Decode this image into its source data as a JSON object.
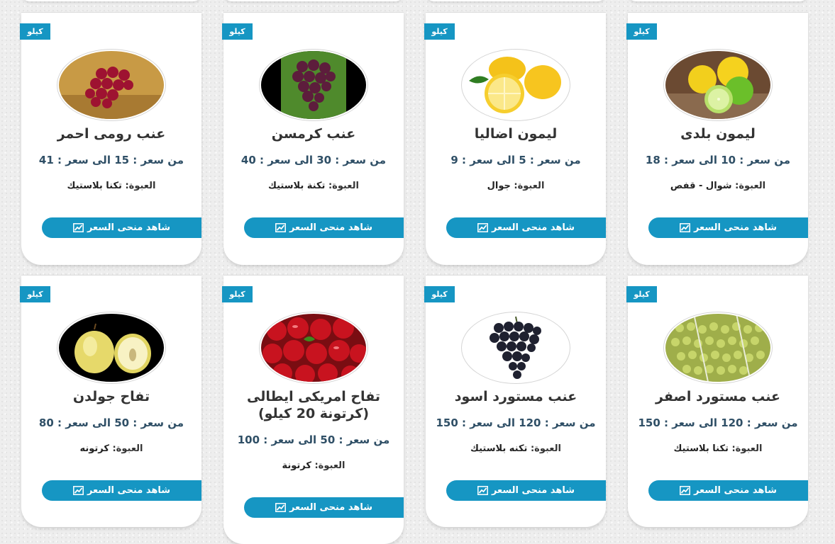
{
  "unit_badge": "كيلو",
  "button_label": "شاهد منحى السعر",
  "pack_prefix": "العبوة:",
  "colors": {
    "accent": "#1696c3",
    "title": "#333333",
    "price": "#2f4f66"
  },
  "icons": {
    "badge": "tag",
    "button": "line-chart-icon"
  },
  "products": [
    {
      "name": "ليمون بلدى",
      "price": "من سعر : 10 الى سعر : 18",
      "pack": "شوال - قفص",
      "image": "baladi-lemons"
    },
    {
      "name": "ليمون اضاليا",
      "price": "من سعر : 5 الى سعر : 9",
      "pack": "جوال",
      "image": "italian-lemons"
    },
    {
      "name": "عنب كرمسن",
      "price": "من سعر : 30 الى سعر : 40",
      "pack": "تكنة بلاستيك",
      "image": "crimson-grapes"
    },
    {
      "name": "عنب رومى احمر",
      "price": "من سعر : 15 الى سعر : 41",
      "pack": "تكنا بلاستيك",
      "image": "red-roman-grapes"
    },
    {
      "name": "عنب مستورد اصفر",
      "price": "من سعر : 120 الى سعر : 150",
      "pack": "تكنا بلاستيك",
      "image": "yellow-grapes"
    },
    {
      "name": "عنب مستورد اسود",
      "price": "من سعر : 120 الى سعر : 150",
      "pack": "تكنه بلاستيك",
      "image": "black-grapes"
    },
    {
      "name": "تفاح امريكى ايطالى (كرتونة 20 كيلو)",
      "price": "من سعر : 50 الى سعر : 100",
      "pack": "كرتونة",
      "image": "red-apples"
    },
    {
      "name": "تفاح جولدن",
      "price": "من سعر : 50 الى سعر : 80",
      "pack": "كرتونه",
      "image": "golden-apples"
    }
  ]
}
